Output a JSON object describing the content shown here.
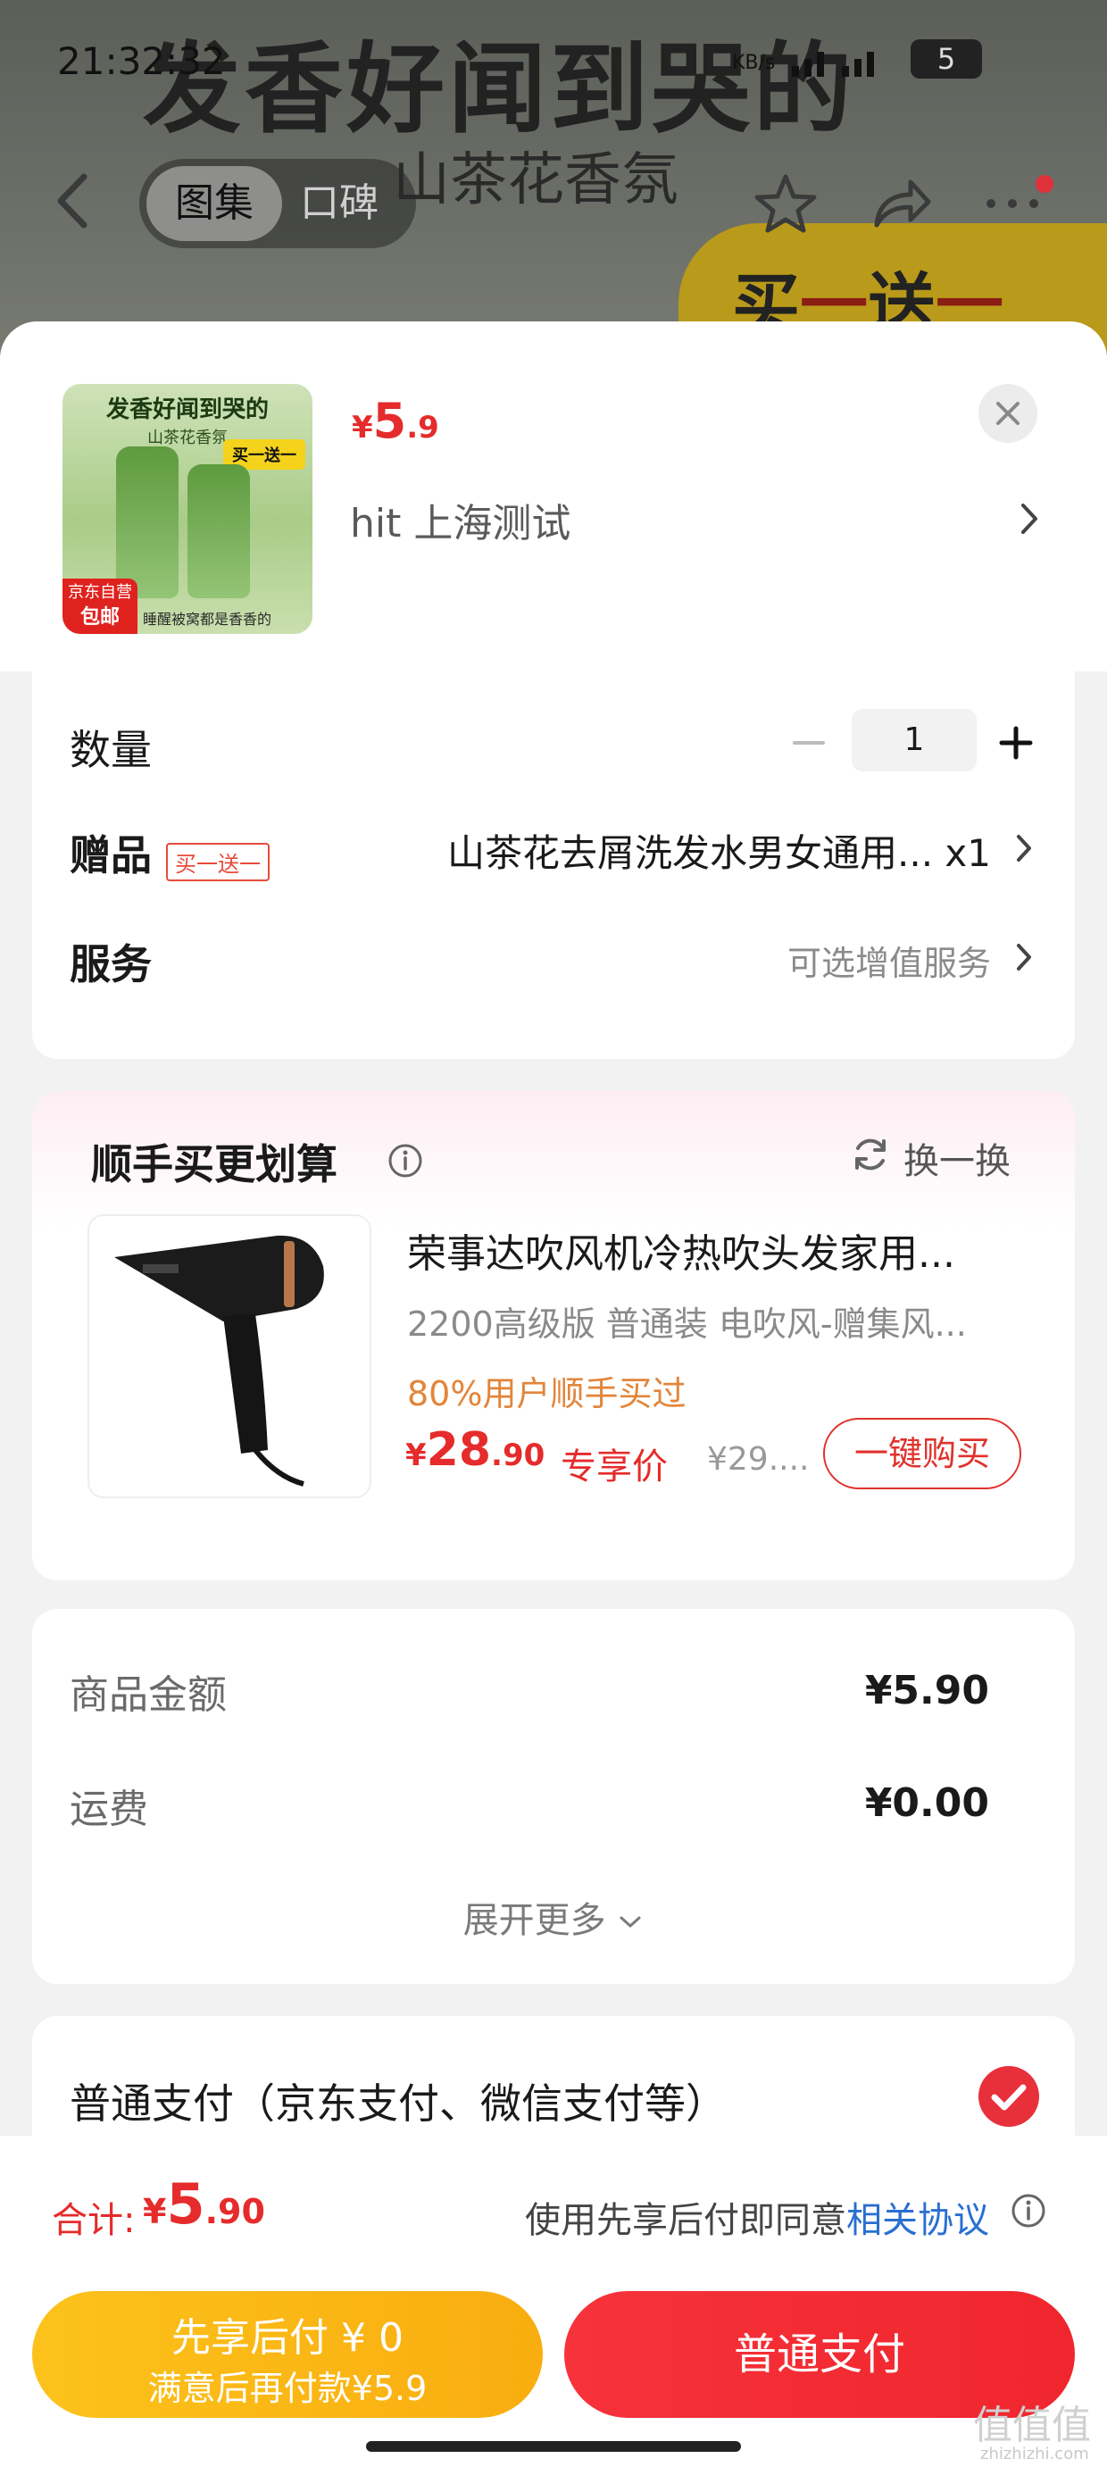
{
  "status_bar": {
    "time": "21:32:32",
    "indicators": "KB/s",
    "battery": "5"
  },
  "background": {
    "banner_title": "发香好闻到哭的",
    "banner_subtitle": "山茶花香氛",
    "promo_part1": "买",
    "promo_part2": "一",
    "promo_part3": "送",
    "promo_part4": "一",
    "nav_tabs": [
      "图集",
      "口碑"
    ],
    "icons": [
      "back-chevron-icon",
      "star-icon",
      "share-icon",
      "more-icon"
    ]
  },
  "product": {
    "thumb_title": "发香好闻到哭的",
    "thumb_subtitle": "山茶花香氛",
    "thumb_tag": "买一送一",
    "thumb_badge_line1": "京东自营",
    "thumb_badge_line2": "包邮",
    "thumb_caption": "睡醒被窝都是香香的",
    "price_currency": "¥",
    "price_int": "5",
    "price_dec": ".9",
    "seller": "hit  上海测试"
  },
  "options": {
    "quantity_label": "数量",
    "quantity_value": "1",
    "gift_label": "赠品",
    "gift_tag": "买一送一",
    "gift_value": "山茶花去屑洗发水男女通用... x1",
    "service_label": "服务",
    "service_value": "可选增值服务"
  },
  "recommend": {
    "title": "顺手买更划算",
    "refresh_label": "换一换",
    "item_name": "荣事达吹风机冷热吹头发家用...",
    "item_spec": "2200高级版 普通装   电吹风-赠集风...",
    "item_stat": "80%用户顺手买过",
    "price_currency": "¥",
    "price_int": "28",
    "price_dec": ".90",
    "price_tag": "专享价",
    "old_price": "¥29....",
    "buy_button": "一键购买"
  },
  "summary": {
    "goods_label": "商品金额",
    "goods_value": "¥5.90",
    "shipping_label": "运费",
    "shipping_value": "¥0.00",
    "expand_label": "展开更多"
  },
  "payment": {
    "option_label": "普通支付（京东支付、微信支付等）",
    "selected": true
  },
  "footer": {
    "total_label": "合计:",
    "total_currency": "¥",
    "total_int": "5",
    "total_dec": ".90",
    "agree_text": "使用先享后付即同意",
    "agree_link": "相关协议",
    "later_line1": "先享后付 ¥ 0",
    "later_line2": "满意后再付款¥5.9",
    "pay_button": "普通支付"
  },
  "watermark": {
    "main": "值值值",
    "sub": "zhizhizhi.com"
  },
  "colors": {
    "price_red": "#e52b2b",
    "later_yellow": "#fcc21b",
    "pay_red": "#f6323a",
    "link_blue": "#2a6fd1",
    "stat_orange": "#e2853a"
  }
}
